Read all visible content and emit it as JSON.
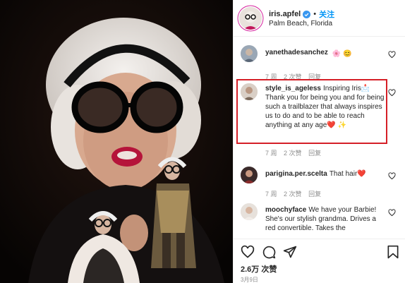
{
  "post": {
    "username": "iris.apfel",
    "separator": "•",
    "follow_label": "关注",
    "location": "Palm Beach, Florida"
  },
  "comments": [
    {
      "username": "yanethadesanchez",
      "text": "",
      "emojis": [
        "🌸",
        "😊"
      ],
      "time": "7 周",
      "likes": "2 次赞",
      "reply": "回复"
    },
    {
      "username": "style_is_ageless",
      "text": "Inspiring Iris📩 Thank you for being you and for being such a trailblazer that always inspires us to do and to be able to reach anything at any age❤️ ✨",
      "time": "7 周",
      "likes": "2 次赞",
      "reply": "回复",
      "highlighted": true
    },
    {
      "username": "parigina.per.scelta",
      "text": "That hair❤️",
      "time": "7 周",
      "likes": "2 次赞",
      "reply": "回复"
    },
    {
      "username": "moochyface",
      "text": "We have your Barbie! She's our stylish grandma. Drives a red convertible. Takes the"
    }
  ],
  "footer": {
    "likes_count": "2.6万 次赞",
    "date": "3月9日"
  },
  "icons": {
    "verified": "verified-badge-icon",
    "like": "heart-icon",
    "comment": "comment-icon",
    "share": "paper-plane-icon",
    "save": "bookmark-icon"
  },
  "colors": {
    "accent_blue": "#0095f6",
    "highlight_red": "#d51f27",
    "meta_gray": "#8e8e8e",
    "text": "#262626"
  }
}
